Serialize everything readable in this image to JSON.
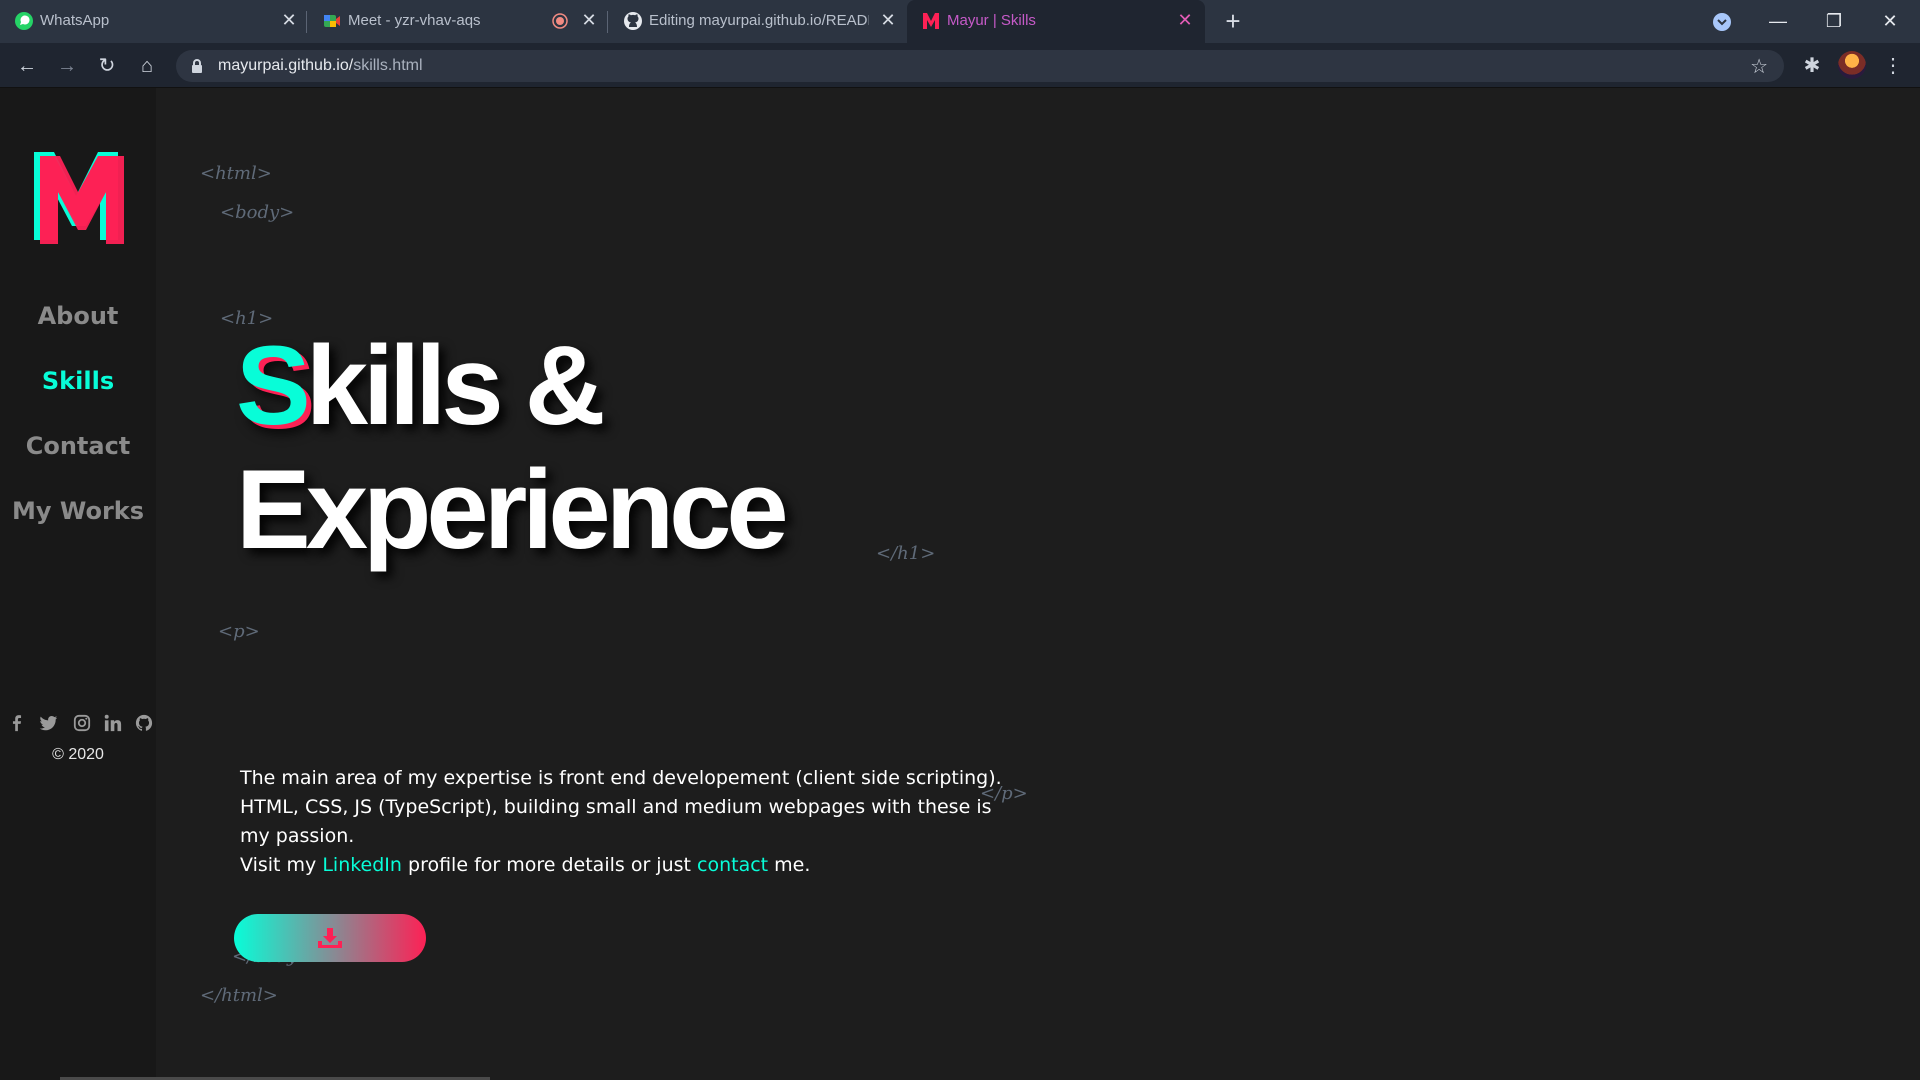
{
  "browser": {
    "tabs": [
      {
        "title": "WhatsApp",
        "icon": "whatsapp-icon"
      },
      {
        "title": "Meet - yzr-vhav-aqs",
        "icon": "google-meet-icon",
        "recording": true
      },
      {
        "title": "Editing mayurpai.github.io/README",
        "icon": "github-icon"
      },
      {
        "title": "Mayur | Skills",
        "icon": "site-m-logo-icon",
        "active": true
      }
    ],
    "url_host": "mayurpai.github.io/",
    "url_path": "skills.html"
  },
  "sidebar": {
    "logo_letter": "M",
    "nav": [
      {
        "label": "About"
      },
      {
        "label": "Skills",
        "active": true
      },
      {
        "label": "Contact"
      },
      {
        "label": "My Works"
      }
    ],
    "social_icons": [
      "facebook-icon",
      "twitter-icon",
      "instagram-icon",
      "linkedin-icon",
      "github-icon"
    ],
    "copyright": "© 2020"
  },
  "main": {
    "tags": {
      "html_open": "<html>",
      "body_open": "<body>",
      "h1_open": "<h1>",
      "h1_close": "</h1>",
      "p_open": "<p>",
      "p_close": "</p>",
      "body_close": "</body>",
      "html_close": "</html>"
    },
    "heading": {
      "first_letter": "S",
      "line1_rest": "kills &",
      "line2": "Experience"
    },
    "paragraph": {
      "line1": "The main area of my expertise is front end developement (client side scripting).",
      "line2": "HTML, CSS, JS (TypeScript), building small and medium webpages with these is",
      "line3": "my passion.",
      "line4_prefix": "Visit my ",
      "linkedin_link": "LinkedIn",
      "line4_middle": " profile for more details or just ",
      "contact_link": "contact",
      "line4_suffix": " me."
    },
    "download_button_icon": "download-icon"
  },
  "colors": {
    "accent_cyan": "#08fdd8",
    "accent_pink": "#fd2155",
    "background": "#1d1d1d",
    "sidebar": "#181818"
  }
}
